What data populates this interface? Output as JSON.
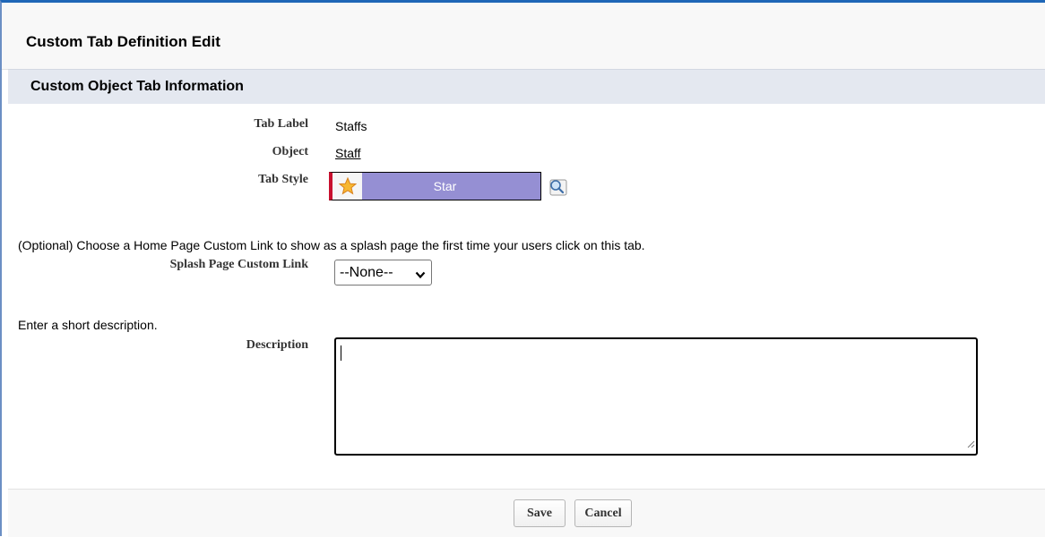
{
  "page": {
    "title": "Custom Tab Definition Edit"
  },
  "section": {
    "title": "Custom Object Tab Information"
  },
  "fields": {
    "tab_label": {
      "label": "Tab Label",
      "value": "Staffs"
    },
    "object": {
      "label": "Object",
      "value": "Staff"
    },
    "tab_style": {
      "label": "Tab Style",
      "value": "Star",
      "icon": "star-icon",
      "color": "#958fd3"
    }
  },
  "splash": {
    "help": "(Optional) Choose a Home Page Custom Link to show as a splash page the first time your users click on this tab.",
    "label": "Splash Page Custom Link",
    "selected": "--None--"
  },
  "description": {
    "help": "Enter a short description.",
    "label": "Description",
    "value": ""
  },
  "buttons": {
    "save": "Save",
    "cancel": "Cancel"
  },
  "colors": {
    "accent_border": "#1f67b7",
    "section_bg": "#e4e8f0",
    "style_marker": "#c8102e"
  }
}
